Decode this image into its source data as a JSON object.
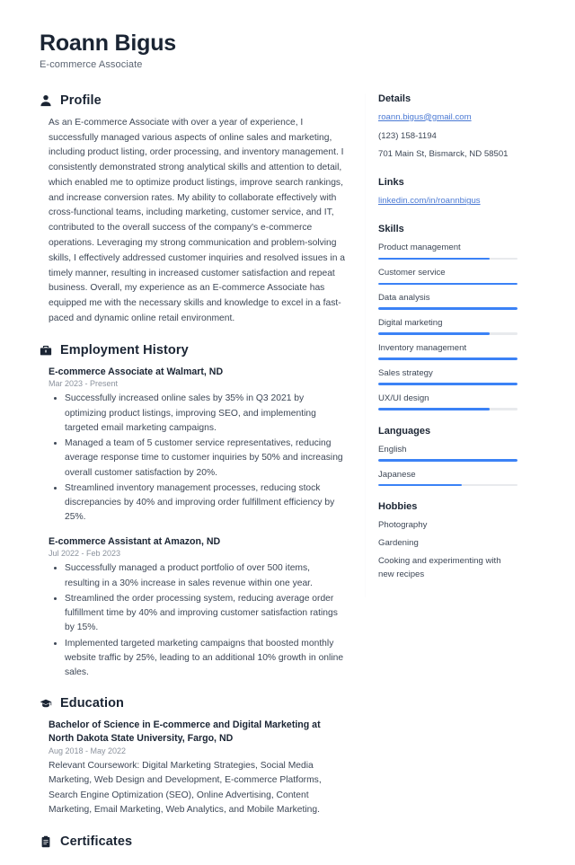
{
  "accent_color": "#3b82f6",
  "link_color": "#4a79d4",
  "header": {
    "name": "Roann Bigus",
    "title": "E-commerce Associate"
  },
  "sections": {
    "profile": {
      "icon": "user-icon",
      "title": "Profile",
      "text": "As an E-commerce Associate with over a year of experience, I successfully managed various aspects of online sales and marketing, including product listing, order processing, and inventory management. I consistently demonstrated strong analytical skills and attention to detail, which enabled me to optimize product listings, improve search rankings, and increase conversion rates. My ability to collaborate effectively with cross-functional teams, including marketing, customer service, and IT, contributed to the overall success of the company's e-commerce operations. Leveraging my strong communication and problem-solving skills, I effectively addressed customer inquiries and resolved issues in a timely manner, resulting in increased customer satisfaction and repeat business. Overall, my experience as an E-commerce Associate has equipped me with the necessary skills and knowledge to excel in a fast-paced and dynamic online retail environment."
    },
    "employment": {
      "icon": "briefcase-icon",
      "title": "Employment History",
      "entries": [
        {
          "title": "E-commerce Associate at Walmart, ND",
          "date": "Mar 2023 - Present",
          "bullets": [
            "Successfully increased online sales by 35% in Q3 2021 by optimizing product listings, improving SEO, and implementing targeted email marketing campaigns.",
            "Managed a team of 5 customer service representatives, reducing average response time to customer inquiries by 50% and increasing overall customer satisfaction by 20%.",
            "Streamlined inventory management processes, reducing stock discrepancies by 40% and improving order fulfillment efficiency by 25%."
          ]
        },
        {
          "title": "E-commerce Assistant at Amazon, ND",
          "date": "Jul 2022 - Feb 2023",
          "bullets": [
            "Successfully managed a product portfolio of over 500 items, resulting in a 30% increase in sales revenue within one year.",
            "Streamlined the order processing system, reducing average order fulfillment time by 40% and improving customer satisfaction ratings by 15%.",
            "Implemented targeted marketing campaigns that boosted monthly website traffic by 25%, leading to an additional 10% growth in online sales."
          ]
        }
      ]
    },
    "education": {
      "icon": "graduation-cap-icon",
      "title": "Education",
      "entries": [
        {
          "title": "Bachelor of Science in E-commerce and Digital Marketing at North Dakota State University, Fargo, ND",
          "date": "Aug 2018 - May 2022",
          "description": "Relevant Coursework: Digital Marketing Strategies, Social Media Marketing, Web Design and Development, E-commerce Platforms, Search Engine Optimization (SEO), Online Advertising, Content Marketing, Email Marketing, Web Analytics, and Mobile Marketing."
        }
      ]
    },
    "certificates": {
      "icon": "clipboard-icon",
      "title": "Certificates"
    }
  },
  "sidebar": {
    "details": {
      "title": "Details",
      "email": "roann.bigus@gmail.com",
      "phone": "(123) 158-1194",
      "address": "701 Main St, Bismarck, ND 58501"
    },
    "links": {
      "title": "Links",
      "items": [
        {
          "label": "linkedin.com/in/roannbigus"
        }
      ]
    },
    "skills": {
      "title": "Skills",
      "items": [
        {
          "label": "Product management",
          "level": 80
        },
        {
          "label": "Customer service",
          "level": 100
        },
        {
          "label": "Data analysis",
          "level": 100
        },
        {
          "label": "Digital marketing",
          "level": 80
        },
        {
          "label": "Inventory management",
          "level": 100
        },
        {
          "label": "Sales strategy",
          "level": 100
        },
        {
          "label": "UX/UI design",
          "level": 80
        }
      ]
    },
    "languages": {
      "title": "Languages",
      "items": [
        {
          "label": "English",
          "level": 100
        },
        {
          "label": "Japanese",
          "level": 60
        }
      ]
    },
    "hobbies": {
      "title": "Hobbies",
      "items": [
        {
          "label": "Photography"
        },
        {
          "label": "Gardening"
        },
        {
          "label": "Cooking and experimenting with new recipes"
        }
      ]
    }
  }
}
